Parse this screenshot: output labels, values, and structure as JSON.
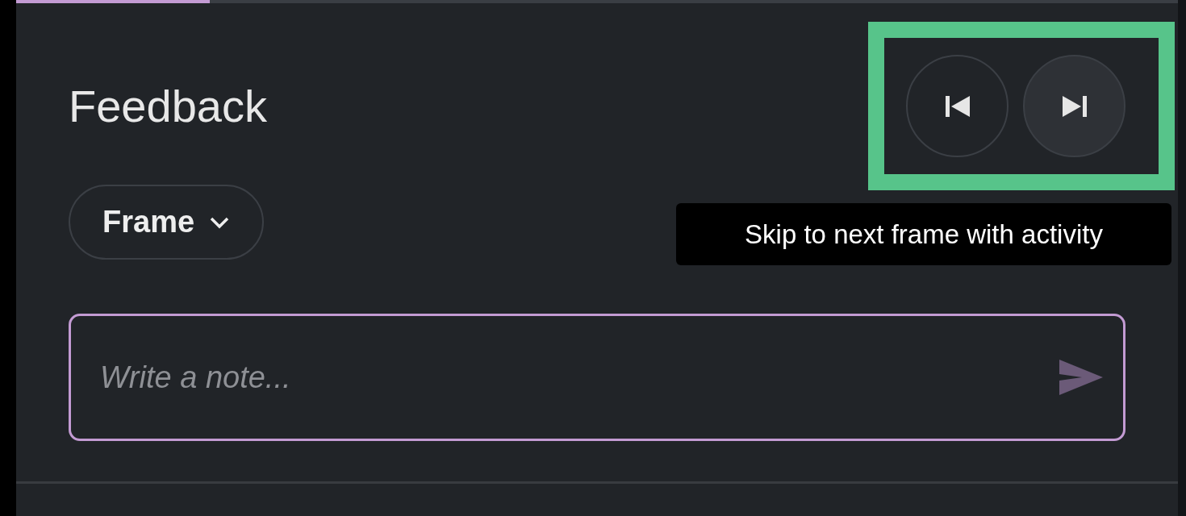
{
  "progress": {
    "level": 0.167
  },
  "title": "Feedback",
  "navigation": {
    "highlighted": true,
    "buttons": [
      {
        "kind": "previous",
        "hovered": false
      },
      {
        "kind": "next",
        "hovered": true
      }
    ]
  },
  "tooltip": "Skip to next frame with activity",
  "filter": {
    "label": "Frame"
  },
  "note": {
    "placeholder": "Write a note..."
  }
}
